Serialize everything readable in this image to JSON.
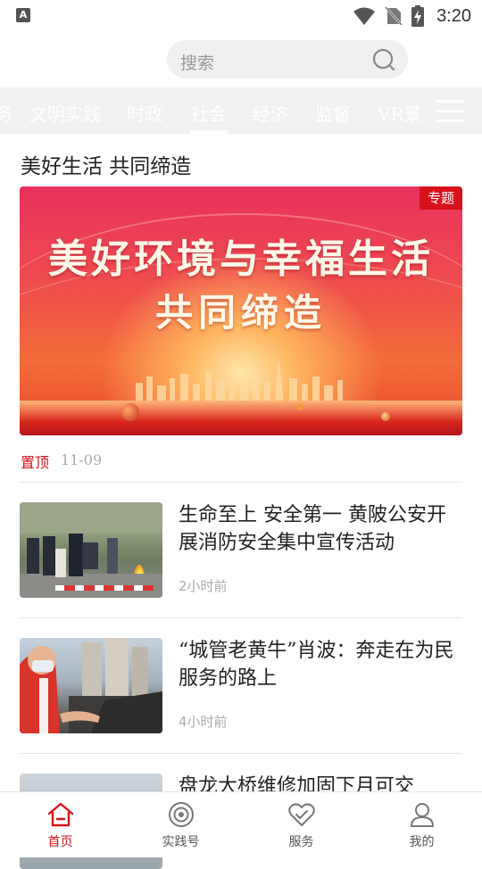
{
  "status_bar": {
    "time": "3:20",
    "left_icon": "A"
  },
  "search": {
    "placeholder": "搜索"
  },
  "tabs": [
    {
      "label": "文明实践"
    },
    {
      "label": "时政"
    },
    {
      "label": "社会"
    },
    {
      "label": "经济"
    },
    {
      "label": "监督"
    },
    {
      "label": "VR景"
    }
  ],
  "active_tab": "社会",
  "feature": {
    "title": "美好生活  共同缔造",
    "banner_line1": "美好环境与幸福生活",
    "banner_line2": "共同缔造",
    "badge": "专题",
    "pin_label": "置顶",
    "date": "11-09"
  },
  "news": [
    {
      "title": "生命至上 安全第一 黄陂公安开展消防安全集中宣传活动",
      "time": "2小时前"
    },
    {
      "title": "“城管老黄牛”肖波：奔走在为民服务的路上",
      "time": "4小时前"
    },
    {
      "title": "盘龙大桥维修加固下月可交"
    }
  ],
  "bottom_nav": [
    {
      "label": "首页",
      "icon": "home-icon",
      "active": true
    },
    {
      "label": "实践号",
      "icon": "practice-icon",
      "active": false
    },
    {
      "label": "服务",
      "icon": "service-icon",
      "active": false
    },
    {
      "label": "我的",
      "icon": "profile-icon",
      "active": false
    }
  ],
  "colors": {
    "accent": "#d8121c",
    "muted": "#aaaaaa"
  }
}
